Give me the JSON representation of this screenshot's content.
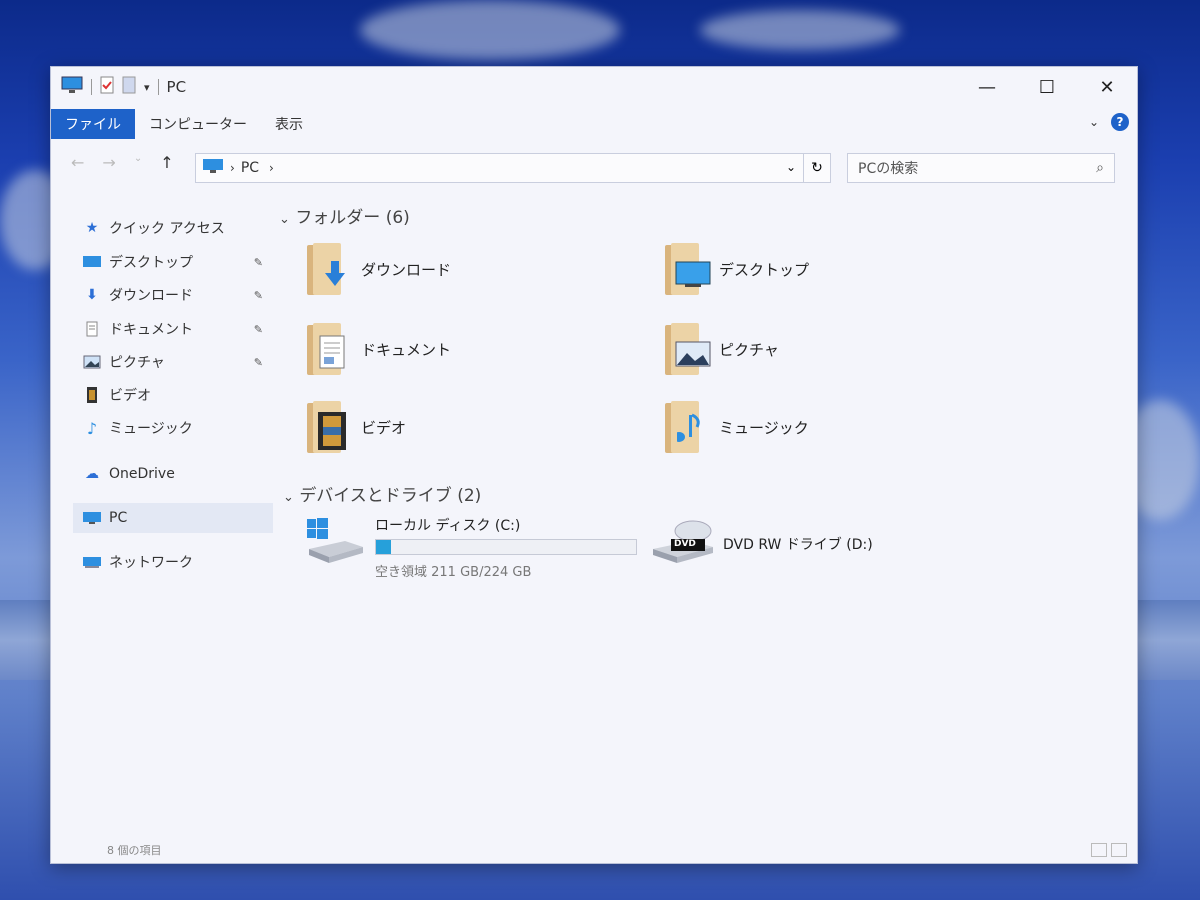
{
  "window": {
    "title": "PC",
    "controls": {
      "minimize": "—",
      "maximize": "☐",
      "close": "✕"
    }
  },
  "ribbon": {
    "tabs": [
      "ファイル",
      "コンピューター",
      "表示"
    ],
    "help": "?"
  },
  "address": {
    "crumb": "PC",
    "search_placeholder": "PCの検索"
  },
  "nav": {
    "quick_access": "クイック アクセス",
    "items": [
      {
        "label": "デスクトップ",
        "icon": "desktop-icon",
        "pinned": true
      },
      {
        "label": "ダウンロード",
        "icon": "download-icon",
        "pinned": true
      },
      {
        "label": "ドキュメント",
        "icon": "document-icon",
        "pinned": true
      },
      {
        "label": "ピクチャ",
        "icon": "picture-icon",
        "pinned": true
      },
      {
        "label": "ビデオ",
        "icon": "video-icon",
        "pinned": false
      },
      {
        "label": "ミュージック",
        "icon": "music-icon",
        "pinned": false
      }
    ],
    "onedrive": "OneDrive",
    "pc": "PC",
    "network": "ネットワーク"
  },
  "content": {
    "folders_header": "フォルダー (6)",
    "folders": [
      {
        "label": "ダウンロード",
        "icon": "download-icon"
      },
      {
        "label": "デスクトップ",
        "icon": "desktop-icon"
      },
      {
        "label": "ドキュメント",
        "icon": "document-icon"
      },
      {
        "label": "ピクチャ",
        "icon": "picture-icon"
      },
      {
        "label": "ビデオ",
        "icon": "video-icon"
      },
      {
        "label": "ミュージック",
        "icon": "music-icon"
      }
    ],
    "drives_header": "デバイスとドライブ (2)",
    "local_disk": {
      "label": "ローカル ディスク (C:)",
      "free_text": "空き領域 211 GB/224 GB",
      "used_fraction": 0.058
    },
    "dvd": {
      "label": "DVD RW ドライブ (D:)",
      "badge": "DVD"
    }
  },
  "status": {
    "items_text": "8 個の項目"
  },
  "colors": {
    "accent": "#1e62c9",
    "drive_bar": "#26a0da",
    "folder": "#ecd3a6"
  }
}
